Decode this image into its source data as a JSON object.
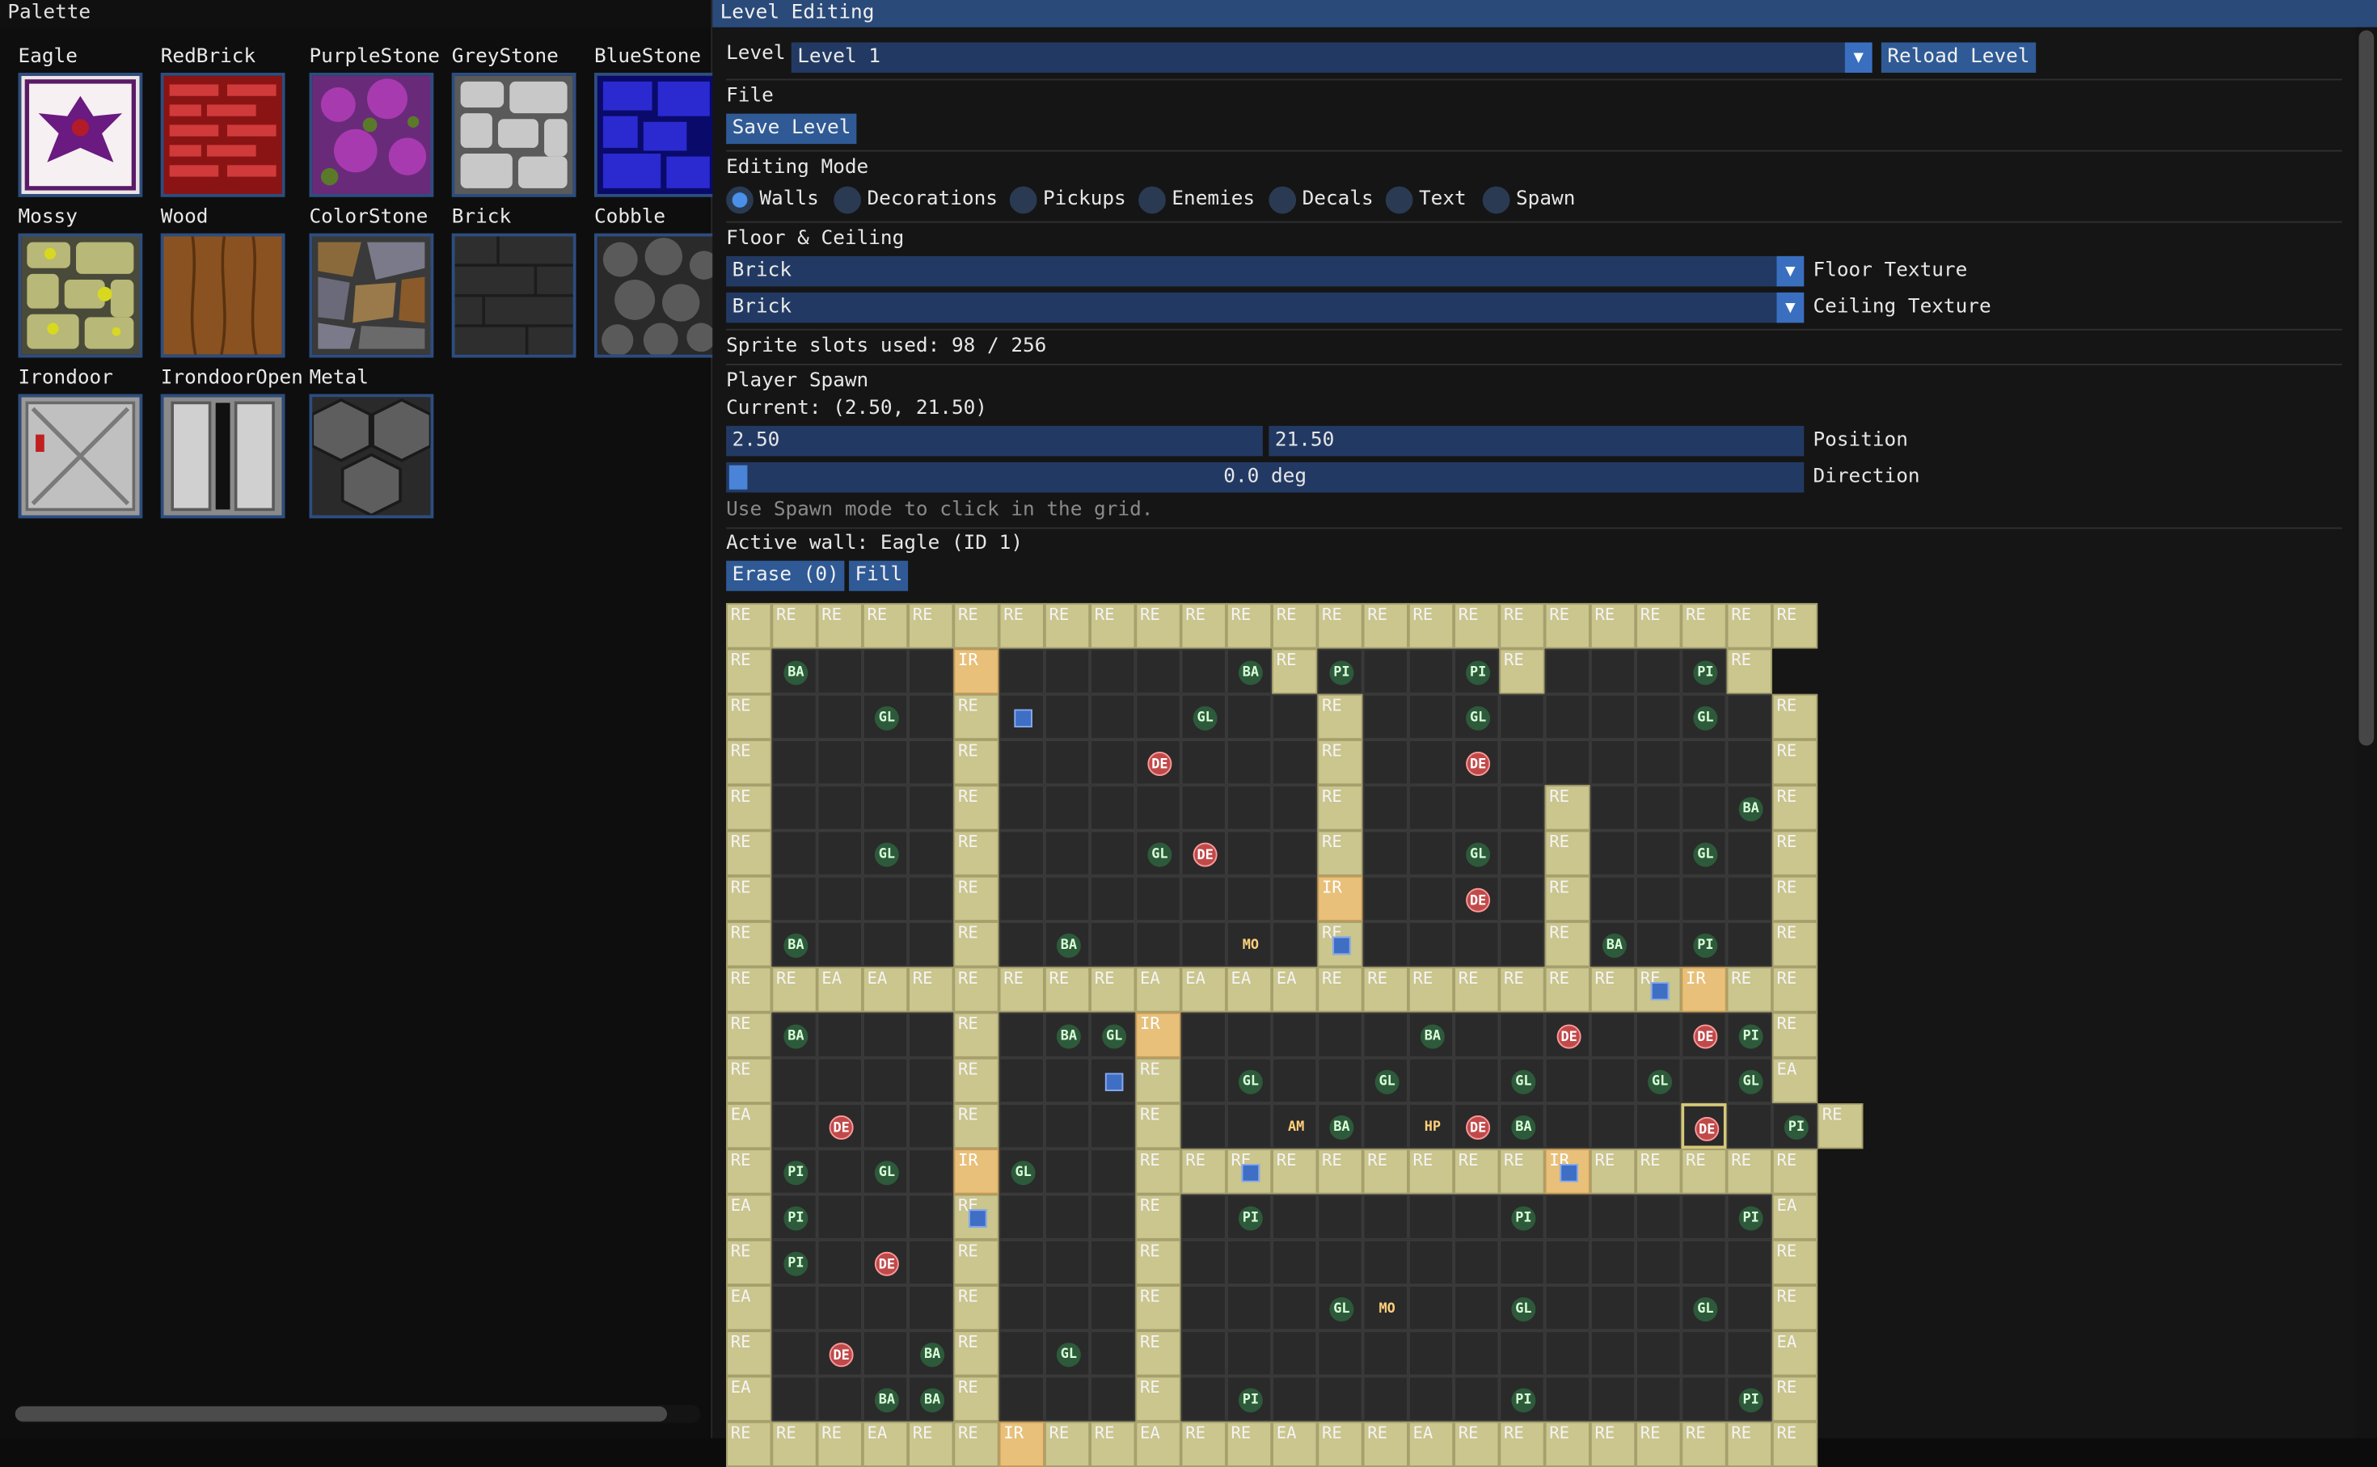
{
  "palette": {
    "title": "Palette",
    "items": [
      {
        "name": "Eagle",
        "icon": "eagle-texture"
      },
      {
        "name": "RedBrick",
        "icon": "redbrick-texture"
      },
      {
        "name": "PurpleStone",
        "icon": "purplestone-texture"
      },
      {
        "name": "GreyStone",
        "icon": "greystone-texture"
      },
      {
        "name": "BlueStone",
        "icon": "bluestone-texture"
      },
      {
        "name": "Mossy",
        "icon": "mossy-texture"
      },
      {
        "name": "Wood",
        "icon": "wood-texture"
      },
      {
        "name": "ColorStone",
        "icon": "colorstone-texture"
      },
      {
        "name": "Brick",
        "icon": "brick-texture"
      },
      {
        "name": "Cobble",
        "icon": "cobble-texture"
      },
      {
        "name": "Irondoor",
        "icon": "irondoor-texture"
      },
      {
        "name": "IrondoorOpen",
        "icon": "irondooropen-texture"
      },
      {
        "name": "Metal",
        "icon": "metal-texture"
      }
    ]
  },
  "editor": {
    "title": "Level Editing",
    "level_label": "Level",
    "level_value": "Level 1",
    "reload_label": "Reload Level",
    "file_label": "File",
    "save_label": "Save Level",
    "mode_label": "Editing Mode",
    "modes": [
      "Walls",
      "Decorations",
      "Pickups",
      "Enemies",
      "Decals",
      "Text",
      "Spawn"
    ],
    "selected_mode": "Walls",
    "floor_ceiling_label": "Floor & Ceiling",
    "floor_value": "Brick",
    "floor_label": "Floor Texture",
    "ceiling_value": "Brick",
    "ceiling_label": "Ceiling Texture",
    "sprite_slots": "Sprite slots used: 98 / 256",
    "spawn_label": "Player Spawn",
    "spawn_current": "Current: (2.50, 21.50)",
    "pos_x": "2.50",
    "pos_y": "21.50",
    "position_label": "Position",
    "direction_value": "0.0 deg",
    "direction_label": "Direction",
    "spawn_hint": "Use Spawn mode to click in the grid.",
    "active_wall": "Active wall: Eagle (ID 1)",
    "erase_label": "Erase (0)",
    "fill_label": "Fill"
  },
  "grid": {
    "rows": [
      "RE RE RE RE RE RE RE RE RE RE RE RE RE RE RE RE RE RE RE RE RE RE RE RE",
      "RE BA . . . IR . . . . . BA RE PI . . PI RE . . . PI RE",
      "RE . . GL . RE . . . . GL . . RE . . GL . . . . GL . RE",
      "RE . . . . RE . . . DE . . . RE . . DE . . . . . . RE",
      "RE . . . . RE . . . . . . . RE . . . . RE . . . BA RE",
      "RE . . GL . RE . . . GL DE . . RE . . GL . RE . . GL . RE",
      "RE . . . . RE . . . . . . . IR . . DE . RE . . . . RE",
      "RE BA . . . RE . BA . . . MO . RE . . . . RE BA . PI . RE",
      "RE RE EA EA RE RE RE RE RE EA EA EA EA RE RE RE RE RE RE RE RE IR RE RE",
      "RE BA . . . RE . BA GL IR . . . . . BA . . DE . . DE PI RE",
      "RE . . . . RE . . . RE . GL . . GL . . GL . . GL . GL EA",
      "EA . DE . . RE . . . RE . . AM BA . HP DE BA . . . DE . PI RE",
      "RE PI . GL . IR GL . . RE RE RE RE RE RE RE RE RE IR RE RE RE RE RE",
      "EA PI . . . RE . . . RE . PI . . . . . PI . . . . PI EA",
      "RE PI . DE . RE . . . RE . . . . . . . . . . . . . RE",
      "EA . . . . RE . . . RE . . . GL MO . . GL . . . GL . RE",
      "RE . DE . BA RE . GL . RE . . . . . . . . . . . . . EA",
      "EA . . BA BA RE . . . RE . PI . . . . . PI . . . . PI RE",
      "RE RE RE EA RE RE IR RE RE EA RE RE EA RE RE EA RE RE RE RE RE RE RE RE"
    ]
  }
}
